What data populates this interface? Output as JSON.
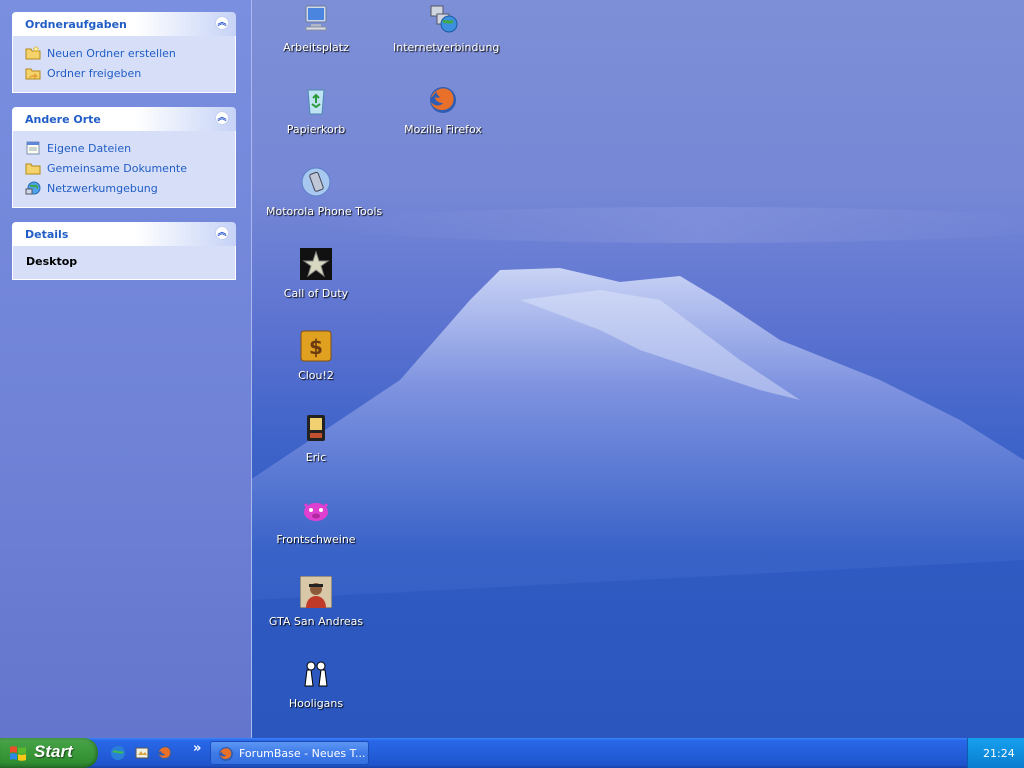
{
  "taskpane": {
    "folder_tasks": {
      "title": "Ordneraufgaben",
      "items": [
        {
          "label": "Neuen Ordner erstellen",
          "icon": "new-folder-icon"
        },
        {
          "label": "Ordner freigeben",
          "icon": "share-folder-icon"
        }
      ]
    },
    "other_places": {
      "title": "Andere Orte",
      "items": [
        {
          "label": "Eigene Dateien",
          "icon": "my-documents-icon"
        },
        {
          "label": "Gemeinsame Dokumente",
          "icon": "shared-documents-icon"
        },
        {
          "label": "Netzwerkumgebung",
          "icon": "network-places-icon"
        }
      ]
    },
    "details": {
      "title": "Details",
      "name": "Desktop"
    }
  },
  "desktop_icons": [
    {
      "label": "Arbeitsplatz",
      "icon": "my-computer-icon"
    },
    {
      "label": "Internetverbindung",
      "icon": "internet-connection-icon"
    },
    {
      "label": "Papierkorb",
      "icon": "recycle-bin-icon"
    },
    {
      "label": "Mozilla Firefox",
      "icon": "firefox-icon"
    },
    {
      "label": "Motorola Phone Tools",
      "icon": "phone-tools-icon"
    },
    {
      "label": "Call of Duty",
      "icon": "call-of-duty-icon"
    },
    {
      "label": "Clou!2",
      "icon": "clou2-icon"
    },
    {
      "label": "Eric",
      "icon": "eric-icon"
    },
    {
      "label": "Frontschweine",
      "icon": "frontschweine-icon"
    },
    {
      "label": "GTA San Andreas",
      "icon": "gta-icon"
    },
    {
      "label": "Hooligans",
      "icon": "hooligans-icon"
    }
  ],
  "taskbar": {
    "start_label": "Start",
    "quick_launch": [
      "ie-icon",
      "desktop-icon",
      "firefox-icon"
    ],
    "more": "»",
    "task_button": "ForumBase - Neues T...",
    "clock": "21:24"
  },
  "colors": {
    "taskbar_blue": "#245edb",
    "start_green": "#3c9a3c",
    "tray_blue": "#0f8fdf",
    "panel_header_text": "#215dc6"
  }
}
